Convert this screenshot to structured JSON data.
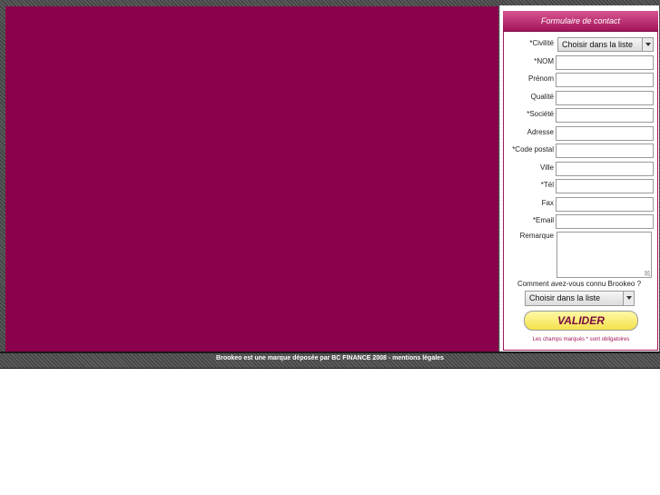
{
  "form": {
    "title": "Formulaire de contact",
    "fields": [
      {
        "label": "*Civilité",
        "type": "select",
        "value": "Choisir dans la liste"
      },
      {
        "label": "*NOM",
        "type": "text",
        "value": ""
      },
      {
        "label": "Prénom",
        "type": "text",
        "value": ""
      },
      {
        "label": "Qualité",
        "type": "text",
        "value": ""
      },
      {
        "label": "*Société",
        "type": "text",
        "value": ""
      },
      {
        "label": "Adresse",
        "type": "text",
        "value": ""
      },
      {
        "label": "*Code postal",
        "type": "text",
        "value": ""
      },
      {
        "label": "Ville",
        "type": "text",
        "value": ""
      },
      {
        "label": "*Tél",
        "type": "text",
        "value": ""
      },
      {
        "label": "Fax",
        "type": "text",
        "value": ""
      },
      {
        "label": "*Email",
        "type": "text",
        "value": ""
      },
      {
        "label": "Remarque",
        "type": "textarea",
        "value": ""
      }
    ],
    "question": "Comment avez-vous connu Brookeo ?",
    "question_select": "Choisir dans la liste",
    "submit_label": "VALIDER",
    "required_note": "Les champs marqués * sont obligatoires"
  },
  "footer": {
    "text": "Brookeo est une marque déposée par BC FINANCE 2008 - mentions légales"
  },
  "colors": {
    "main_panel": "#8a004b",
    "header_gradient_top": "#d85592",
    "header_gradient_bottom": "#a3145a",
    "button": "#f3e14a"
  }
}
